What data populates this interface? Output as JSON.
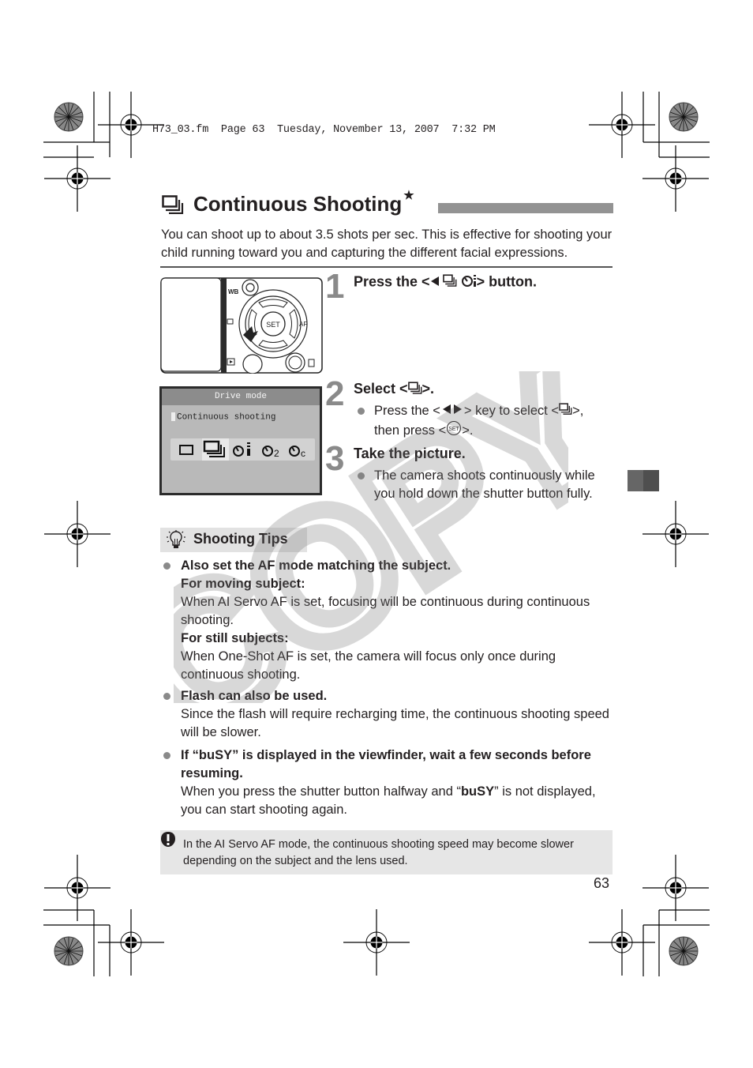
{
  "header": {
    "file_line": "H73_03.fm  Page 63  Tuesday, November 13, 2007  7:32 PM"
  },
  "section": {
    "icon": "continuous-shooting-icon",
    "title": "Continuous Shooting",
    "star": "★",
    "intro": "You can shoot up to about 3.5 shots per sec. This is effective for shooting your child running toward you and capturing the different facial expressions."
  },
  "steps": [
    {
      "number": "1",
      "title_prefix": "Press the <",
      "title_suffix": "> button.",
      "icons": [
        "left-arrow-icon",
        "continuous-shooting-icon",
        "self-timer-remote-icon"
      ]
    },
    {
      "number": "2",
      "title_prefix": "Select <",
      "title_suffix": ">.",
      "bullet_line1_a": "Press the <",
      "bullet_line1_b": "> key to select <",
      "bullet_line1_c": ">,",
      "bullet_line2_a": "then press <",
      "bullet_line2_b": ">.",
      "set_label": "SET"
    },
    {
      "number": "3",
      "title": "Take the picture.",
      "bullet": "The camera shoots continuously while you hold down the shutter button fully."
    }
  ],
  "camera_illustration": {
    "labels": [
      "WB",
      "SET",
      "AF"
    ]
  },
  "lcd": {
    "header": "Drive mode",
    "selected_label": "Continuous shooting",
    "options": [
      "single-shooting-icon",
      "continuous-shooting-icon",
      "self-timer-remote-icon",
      "self-timer-2s-icon",
      "self-timer-continuous-icon"
    ],
    "selected_index": 1
  },
  "tips": {
    "title": "Shooting Tips",
    "items": [
      {
        "heading": "Also set the AF mode matching the subject.",
        "sub1_heading": "For moving subject:",
        "sub1_text": "When AI Servo AF is set, focusing will be continuous during continuous shooting.",
        "sub2_heading": "For still subjects:",
        "sub2_text": "When One-Shot AF is set, the camera will focus only once during continuous shooting."
      },
      {
        "heading": "Flash can also be used.",
        "text": "Since the flash will require recharging time, the continuous shooting speed will be slower."
      },
      {
        "heading": "If “buSY” is displayed in the viewfinder, wait a few seconds before resuming.",
        "text_a": "When you press the shutter button halfway and “",
        "text_bold": "buSY",
        "text_b": "” is not displayed, you can start shooting again."
      }
    ]
  },
  "note": {
    "icon": "caution-icon",
    "text": "In the AI Servo AF mode, the continuous shooting speed may become slower depending on the subject and the lens used."
  },
  "watermark": "COPY",
  "page_number": "63"
}
